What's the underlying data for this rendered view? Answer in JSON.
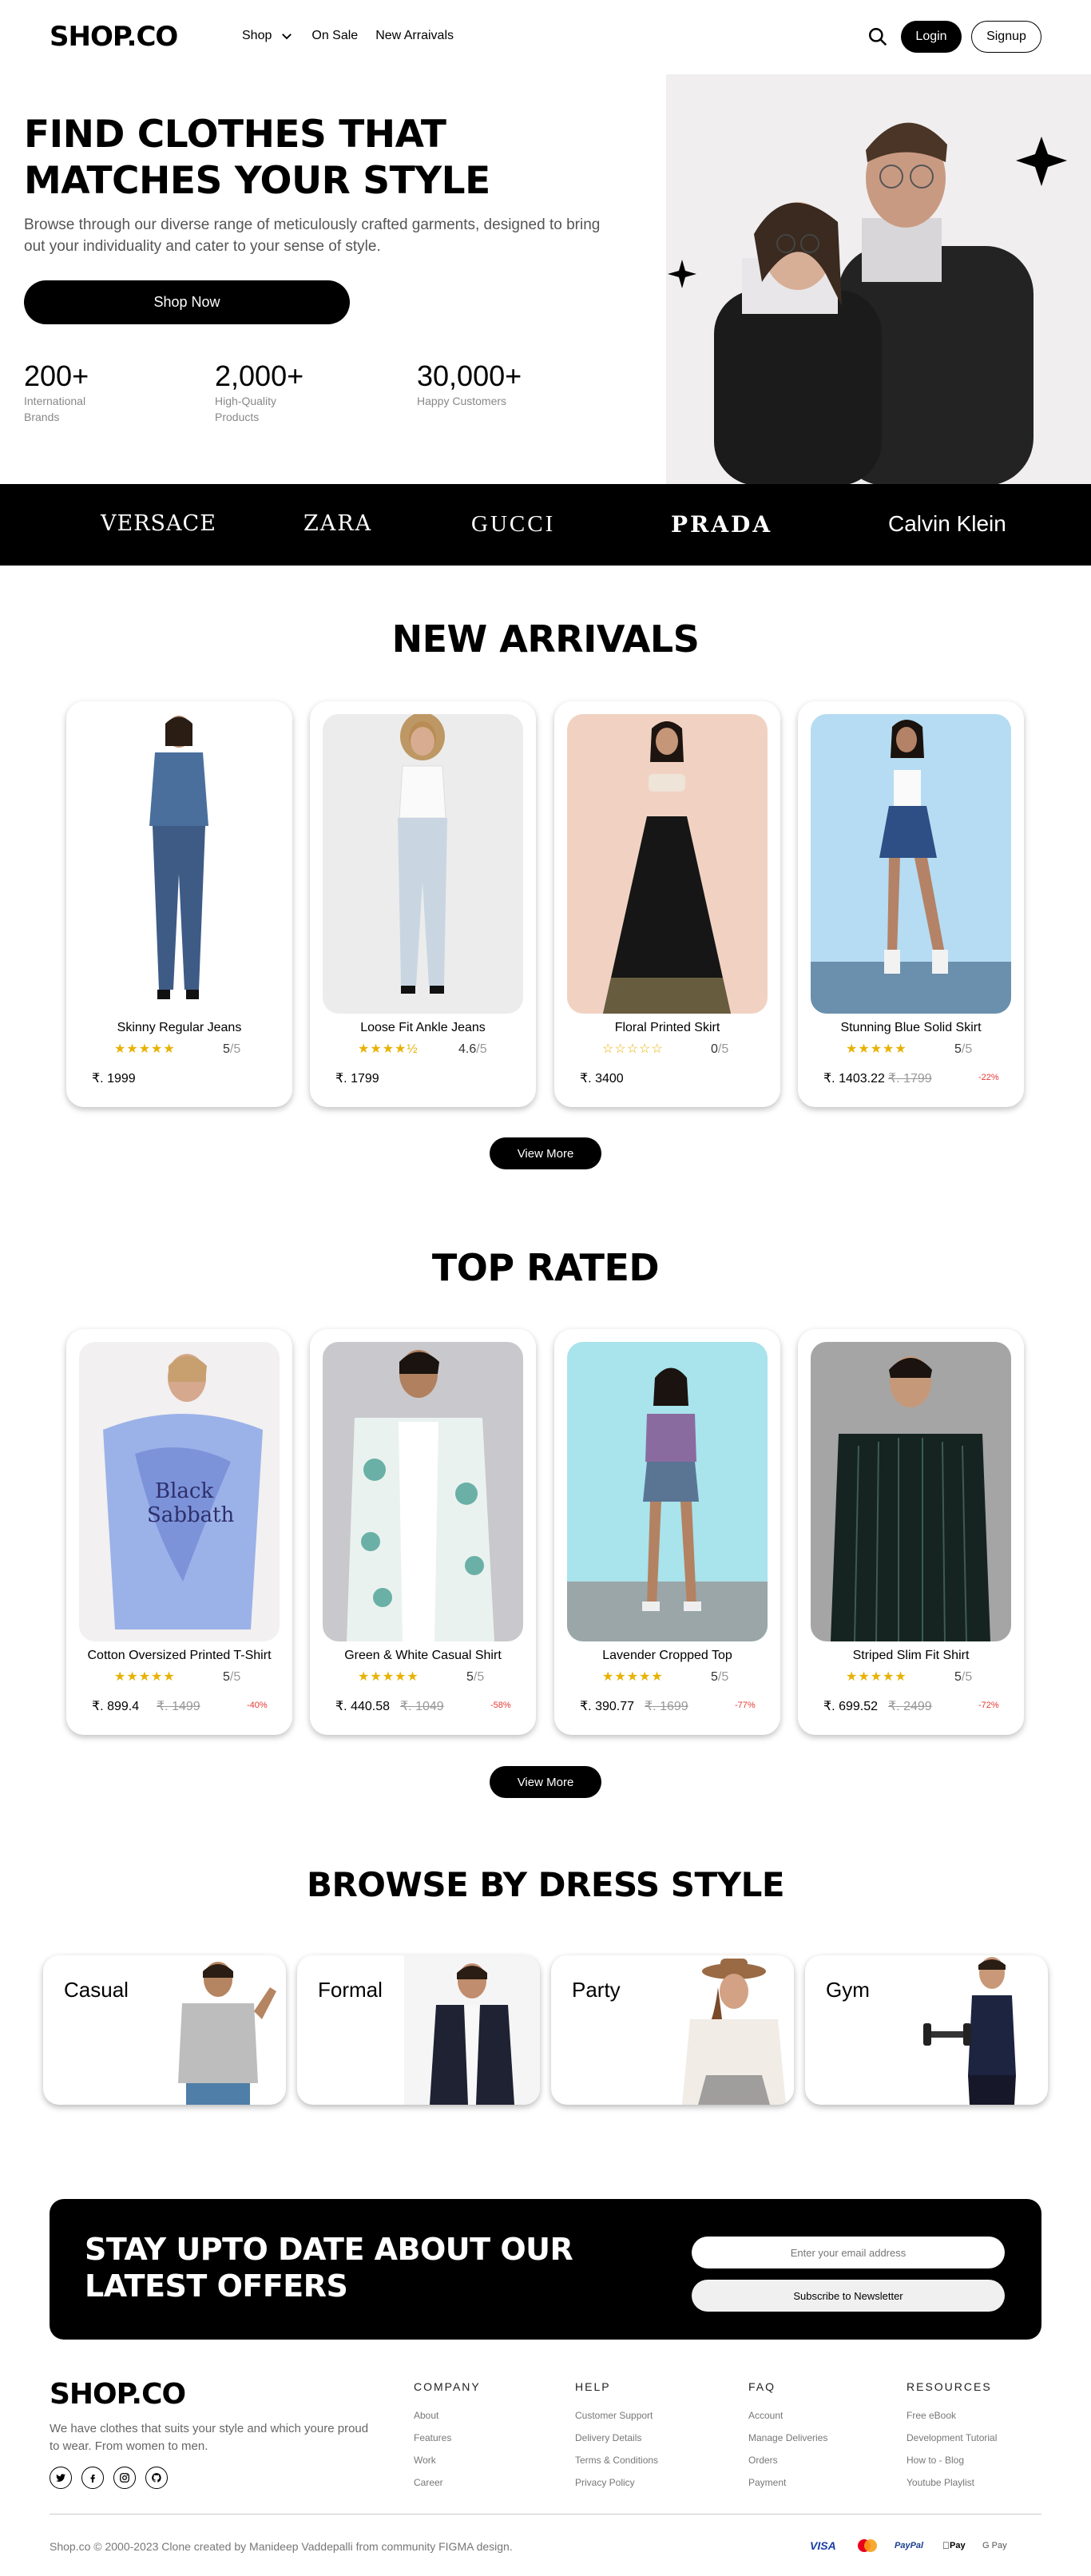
{
  "nav": {
    "logo": "SHOP.CO",
    "links": [
      "Shop",
      "On Sale",
      "New Arraivals"
    ],
    "login": "Login",
    "signup": "Signup"
  },
  "hero": {
    "title_line1": "FIND CLOTHES THAT",
    "title_line2": "MATCHES YOUR STYLE",
    "subtitle": "Browse through our diverse range of meticulously crafted garments, designed to bring out your individuality and cater to your sense of style.",
    "cta": "Shop Now",
    "stats": [
      {
        "value": "200+",
        "label": "International Brands"
      },
      {
        "value": "2,000+",
        "label": "High-Quality Products"
      },
      {
        "value": "30,000+",
        "label": "Happy Customers"
      }
    ]
  },
  "brands": [
    "VERSACE",
    "ZARA",
    "GUCCI",
    "PRADA",
    "Calvin Klein"
  ],
  "new_arrivals": {
    "title": "NEW ARRIVALS",
    "more": "View More",
    "products": [
      {
        "name": "Skinny Regular Jeans",
        "stars": "★★★★★",
        "rating": "5",
        "of": "/5",
        "price": "₹. 1999",
        "old": "",
        "disc": ""
      },
      {
        "name": "Loose Fit Ankle Jeans",
        "stars": "★★★★½",
        "rating": "4.6",
        "of": "/5",
        "price": "₹. 1799",
        "old": "",
        "disc": ""
      },
      {
        "name": "Floral Printed Skirt",
        "stars": "☆☆☆☆☆",
        "rating": "0",
        "of": "/5",
        "price": "₹. 3400",
        "old": "",
        "disc": ""
      },
      {
        "name": "Stunning Blue Solid Skirt",
        "stars": "★★★★★",
        "rating": "5",
        "of": "/5",
        "price": "₹. 1403.22",
        "old": "₹. 1799",
        "disc": "-22%"
      }
    ]
  },
  "top_rated": {
    "title": "TOP RATED",
    "more": "View More",
    "products": [
      {
        "name": "Cotton Oversized Printed T-Shirt",
        "stars": "★★★★★",
        "rating": "5",
        "of": "/5",
        "price": "₹. 899.4",
        "old": "₹. 1499",
        "disc": "-40%"
      },
      {
        "name": "Green & White Casual Shirt",
        "stars": "★★★★★",
        "rating": "5",
        "of": "/5",
        "price": "₹. 440.58",
        "old": "₹. 1049",
        "disc": "-58%"
      },
      {
        "name": "Lavender Cropped Top",
        "stars": "★★★★★",
        "rating": "5",
        "of": "/5",
        "price": "₹. 390.77",
        "old": "₹. 1699",
        "disc": "-77%"
      },
      {
        "name": "Striped Slim Fit Shirt",
        "stars": "★★★★★",
        "rating": "5",
        "of": "/5",
        "price": "₹. 699.52",
        "old": "₹. 2499",
        "disc": "-72%"
      }
    ]
  },
  "dress_style": {
    "title": "BROWSE BY DRESS STYLE",
    "styles": [
      "Casual",
      "Formal",
      "Party",
      "Gym"
    ]
  },
  "newsletter": {
    "title": "STAY UPTO DATE ABOUT OUR LATEST OFFERS",
    "placeholder": "Enter your email address",
    "button": "Subscribe to Newsletter"
  },
  "footer": {
    "logo": "SHOP.CO",
    "description": "We have clothes that suits your style and which youre proud to wear. From women to men.",
    "columns": [
      {
        "heading": "COMPANY",
        "items": [
          "About",
          "Features",
          "Work",
          "Career"
        ]
      },
      {
        "heading": "HELP",
        "items": [
          "Customer Support",
          "Delivery Details",
          "Terms & Conditions",
          "Privacy Policy"
        ]
      },
      {
        "heading": "FAQ",
        "items": [
          "Account",
          "Manage Deliveries",
          "Orders",
          "Payment"
        ]
      },
      {
        "heading": "RESOURCES",
        "items": [
          "Free eBook",
          "Development Tutorial",
          "How to - Blog",
          "Youtube Playlist"
        ]
      }
    ],
    "copyright": "Shop.co © 2000-2023 Clone created by Manideep Vaddepalli from community FIGMA design.",
    "payments": [
      "VISA",
      "PayPal",
      "Pay",
      "G Pay"
    ]
  }
}
